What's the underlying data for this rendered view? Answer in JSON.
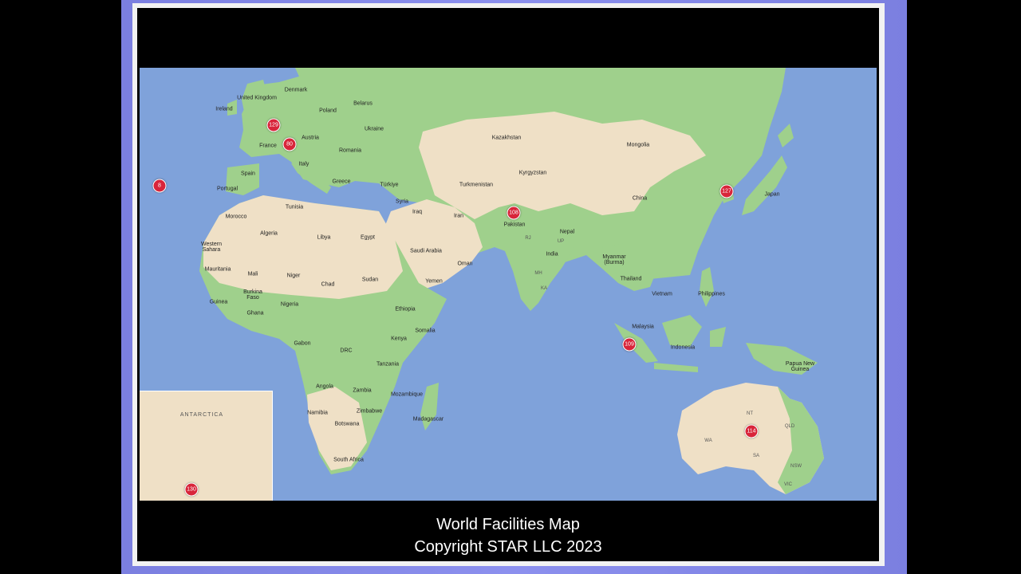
{
  "caption": {
    "title": "World Facilities Map",
    "copyright": "Copyright STAR LLC 2023"
  },
  "map": {
    "inset_title": "ANTARCTICA",
    "colors": {
      "ocean": "#7fa2da",
      "vegetation": "#9fd08c",
      "desert": "#efe0c6",
      "marker": "#d8253a"
    },
    "labels": [
      "Denmark",
      "United Kingdom",
      "Ireland",
      "Belarus",
      "Poland",
      "Ukraine",
      "Austria",
      "France",
      "Romania",
      "Italy",
      "Spain",
      "Portugal",
      "Greece",
      "Türkiye",
      "Kazakhstan",
      "Mongolia",
      "Kyrgyzstan",
      "Turkmenistan",
      "China",
      "Japan",
      "Syria",
      "Iraq",
      "Iran",
      "Pakistan",
      "Nepal",
      "Tunisia",
      "Morocco",
      "Algeria",
      "Libya",
      "Egypt",
      "Saudi Arabia",
      "Oman",
      "Western Sahara",
      "Mauritania",
      "Mali",
      "Niger",
      "Chad",
      "Sudan",
      "Yemen",
      "India",
      "Myanmar (Burma)",
      "Thailand",
      "Vietnam",
      "Philippines",
      "Burkina Faso",
      "Nigeria",
      "Guinea",
      "Ghana",
      "Ethiopia",
      "Somalia",
      "Malaysia",
      "Gabon",
      "DRC",
      "Kenya",
      "Indonesia",
      "Tanzania",
      "Papua New Guinea",
      "Angola",
      "Zambia",
      "Mozambique",
      "Namibia",
      "Zimbabwe",
      "Madagascar",
      "Botswana",
      "South Africa",
      "NT",
      "QLD",
      "WA",
      "SA",
      "NSW",
      "VIC",
      "RJ",
      "UP",
      "MH",
      "KA"
    ],
    "markers": [
      "129",
      "80",
      "8",
      "127",
      "108",
      "109",
      "114",
      "130"
    ]
  }
}
